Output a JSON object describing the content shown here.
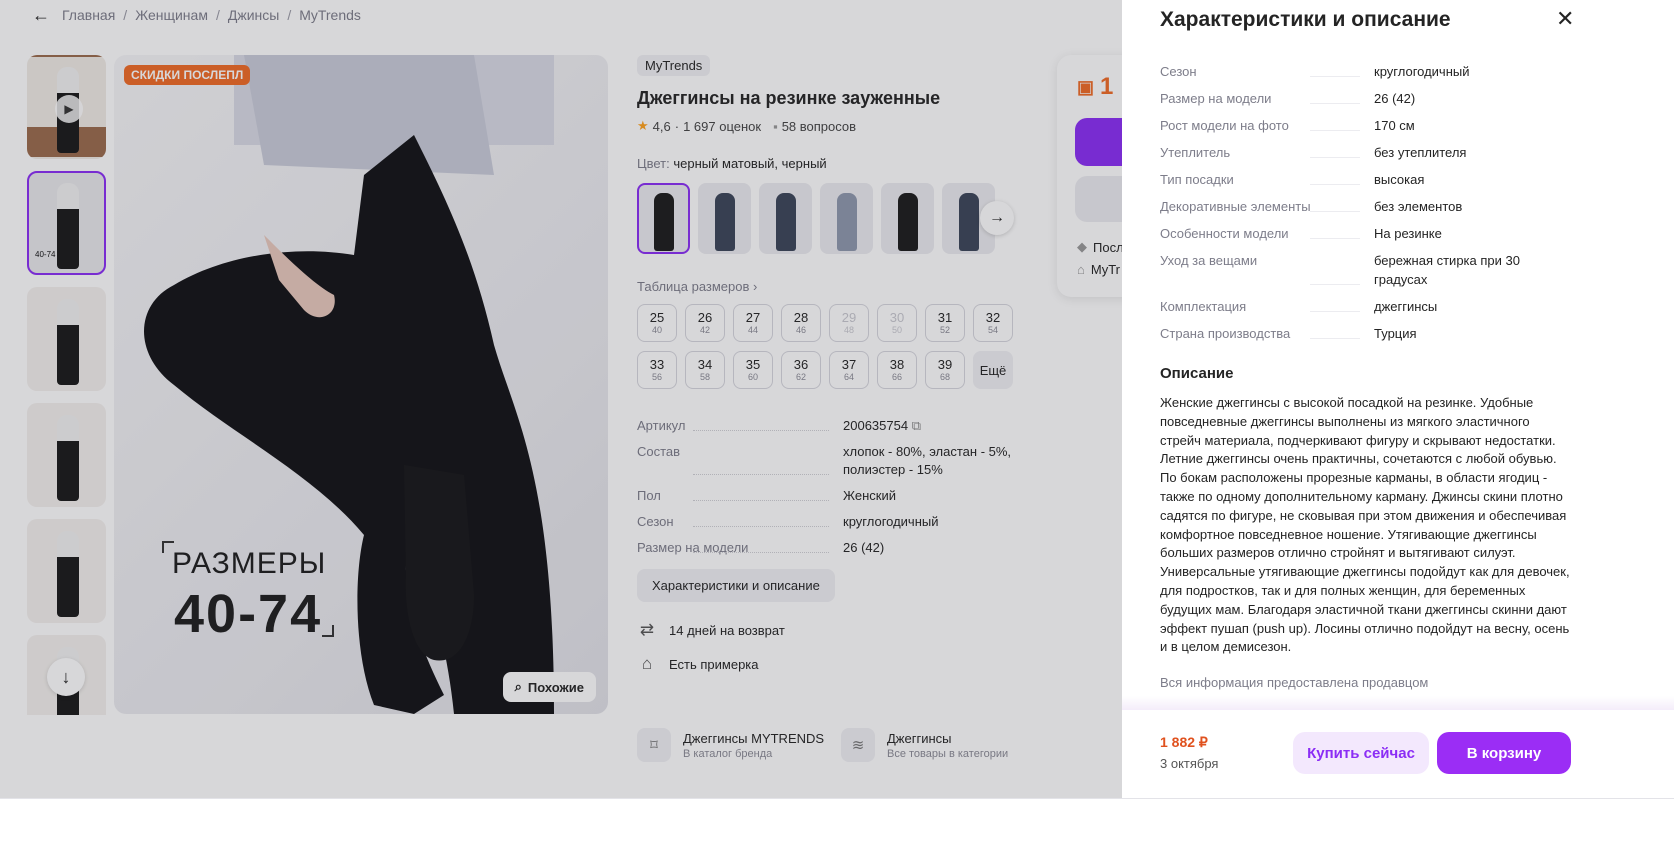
{
  "breadcrumb": [
    "Главная",
    "Женщинам",
    "Джинсы",
    "MyTrends"
  ],
  "gallery": {
    "sale_badge": "СКИДКИ ПОСЛЕПЛ",
    "caption_line1": "РАЗМЕРЫ",
    "caption_line2": "40-74",
    "similar_label": "Похожие",
    "thumb_caption": "40-74"
  },
  "product": {
    "brand": "MyTrends",
    "title": "Джеггинсы на резинке зауженные",
    "rating": "4,6",
    "reviews": "1 697 оценок",
    "questions": "58 вопросов",
    "color_label": "Цвет:",
    "color_value": "черный матовый, черный",
    "size_table_link": "Таблица размеров",
    "sizes": [
      {
        "ru": "25",
        "eu": "40",
        "available": true
      },
      {
        "ru": "26",
        "eu": "42",
        "available": true
      },
      {
        "ru": "27",
        "eu": "44",
        "available": true
      },
      {
        "ru": "28",
        "eu": "46",
        "available": true
      },
      {
        "ru": "29",
        "eu": "48",
        "available": false
      },
      {
        "ru": "30",
        "eu": "50",
        "available": false
      },
      {
        "ru": "31",
        "eu": "52",
        "available": true
      },
      {
        "ru": "32",
        "eu": "54",
        "available": true
      },
      {
        "ru": "33",
        "eu": "56",
        "available": true
      },
      {
        "ru": "34",
        "eu": "58",
        "available": true
      },
      {
        "ru": "35",
        "eu": "60",
        "available": true
      },
      {
        "ru": "36",
        "eu": "62",
        "available": true
      },
      {
        "ru": "37",
        "eu": "64",
        "available": true
      },
      {
        "ru": "38",
        "eu": "66",
        "available": true
      },
      {
        "ru": "39",
        "eu": "68",
        "available": true
      }
    ],
    "more_sizes": "Ещё",
    "attributes": [
      {
        "k": "Артикул",
        "v": "200635754"
      },
      {
        "k": "Состав",
        "v": "хлопок - 80%, эластан - 5%, полиэстер - 15%"
      },
      {
        "k": "Пол",
        "v": "Женский"
      },
      {
        "k": "Сезон",
        "v": "круглогодичный"
      },
      {
        "k": "Размер на модели",
        "v": "26 (42)"
      }
    ],
    "char_button": "Характеристики и описание",
    "return_policy": "14 дней на возврат",
    "fitting": "Есть примерка"
  },
  "bottom_links": [
    {
      "title": "Джеггинсы MYTRENDS",
      "sub": "В каталог бренда"
    },
    {
      "title": "Джеггинсы",
      "sub": "Все товары в категории"
    }
  ],
  "buy_card": {
    "price_partial": "1",
    "line1": "Посл",
    "line2": "MyTr"
  },
  "panel": {
    "title": "Характеристики и описание",
    "specs": [
      {
        "k": "Сезон",
        "v": "круглогодичный"
      },
      {
        "k": "Размер на модели",
        "v": "26 (42)"
      },
      {
        "k": "Рост модели на фото",
        "v": "170 см"
      },
      {
        "k": "Утеплитель",
        "v": "без утеплителя"
      },
      {
        "k": "Тип посадки",
        "v": "высокая"
      },
      {
        "k": "Декоративные элементы",
        "v": "без элементов"
      },
      {
        "k": "Особенности модели",
        "v": "На резинке"
      },
      {
        "k": "Уход за вещами",
        "v": "бережная стирка при 30 градусах"
      },
      {
        "k": "Комплектация",
        "v": "джеггинсы"
      },
      {
        "k": "Страна производства",
        "v": "Турция"
      }
    ],
    "desc_title": "Описание",
    "description": "Женские джеггинсы с высокой посадкой на резинке. Удобные повседневные джеггинсы выполнены из мягкого эластичного стрейч материала, подчеркивают фигуру и скрывают недостатки. Летние джеггинсы очень практичны, сочетаются с любой обувью. По бокам расположены прорезные карманы, в области ягодиц - также по одному дополнительному карману. Джинсы скини плотно садятся по фигуре, не сковывая при этом движения и обеспечивая комфортное повседневное ношение. Утягивающие джеггинсы больших размеров отлично стройнят и вытягивают силуэт. Универсальные утягивающие джеггинсы подойдут как для девочек, для подростков, так и для полных женщин, для беременных будущих мам. Благодаря эластичной ткани джеггинсы скинни дают эффект пушап (push up). Лосины отлично подойдут на весну, осень и в целом демисезон.",
    "seller_note": "Вся информация предоставлена продавцом",
    "footer_price": "1 882 ₽",
    "footer_date": "3 октября",
    "buy_now": "Купить сейчас",
    "add_to_cart": "В корзину"
  },
  "colors": {
    "accent": "#8b2df5",
    "price": "#e0521f",
    "star": "#ffa21b"
  }
}
